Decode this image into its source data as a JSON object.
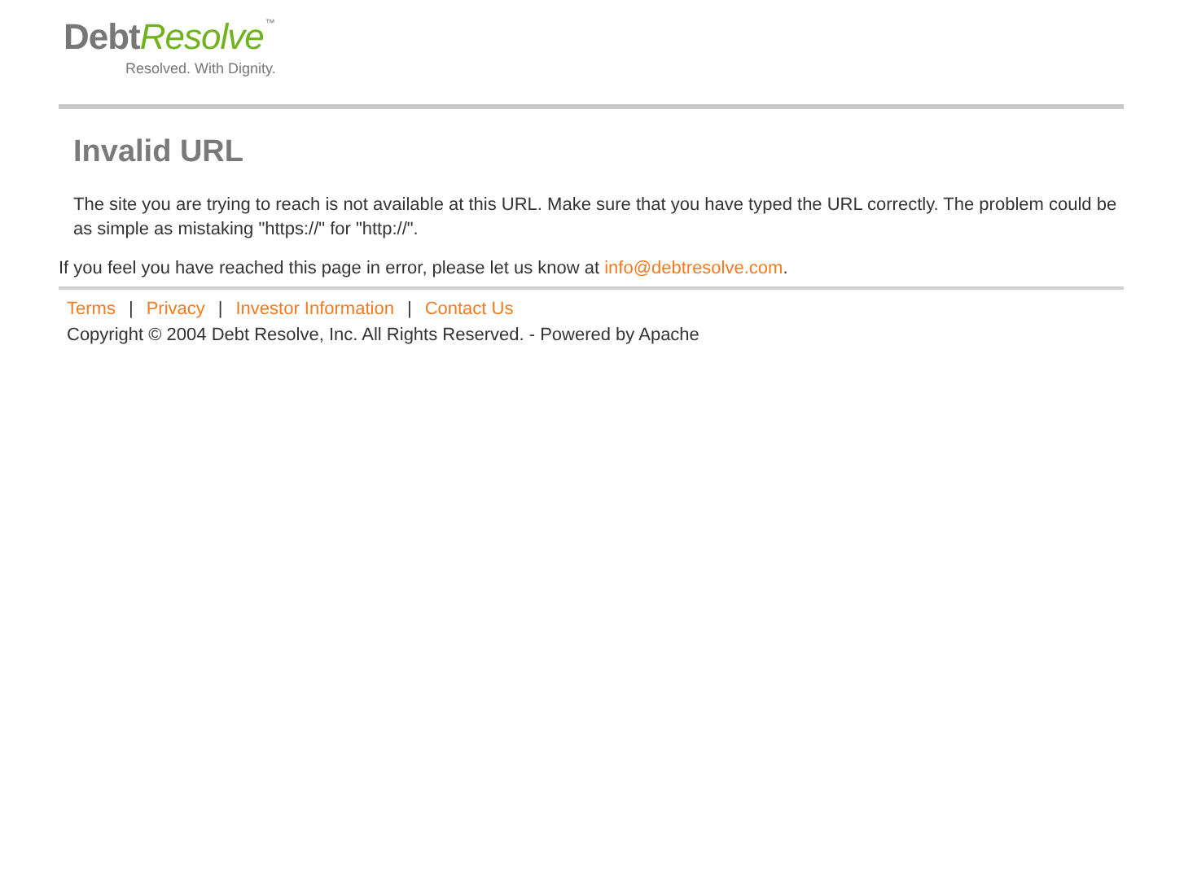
{
  "logo": {
    "word_1": "Debt",
    "word_2": "Resolve",
    "trademark": "™",
    "tagline": "Resolved. With Dignity."
  },
  "heading": "Invalid URL",
  "message": "The site you are trying to reach is not available at this URL. Make sure that you have typed the URL correctly. The problem could be as simple as mistaking \"https://\" for \"http://\".",
  "error_note": {
    "text": "If you feel you have reached this page in error, please let us know at",
    "email": "info@debtresolve.com",
    "end": "."
  },
  "footer_links": [
    {
      "label": "Terms"
    },
    {
      "label": "Privacy"
    },
    {
      "label": "Investor Information"
    },
    {
      "label": "Contact Us"
    }
  ],
  "separator": "|",
  "copyright": "Copyright © 2004 Debt Resolve, Inc. All Rights Reserved. - Powered by Apache"
}
